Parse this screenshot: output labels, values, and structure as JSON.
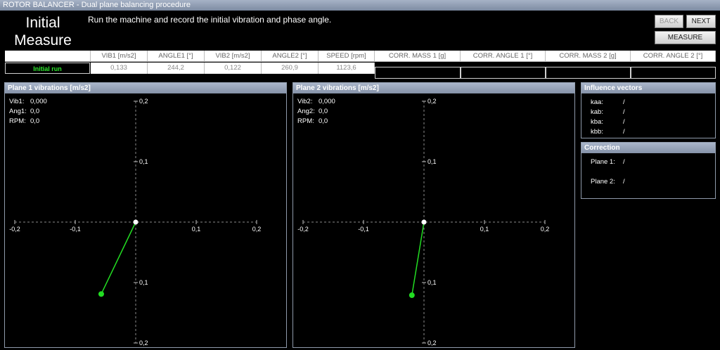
{
  "window": {
    "title": "ROTOR BALANCER - Dual plane balancing procedure"
  },
  "step": {
    "title_line1": "Initial",
    "title_line2": "Measure",
    "instruction": "Run the machine and record the initial vibration and phase angle."
  },
  "buttons": {
    "back": "BACK",
    "next": "NEXT",
    "measure": "MEASURE"
  },
  "table": {
    "headers": [
      "VIB1 [m/s2]",
      "ANGLE1 [°]",
      "VIB2 [m/s2]",
      "ANGLE2 [°]",
      "SPEED [rpm]"
    ],
    "row_label": "Initial run",
    "values": [
      "0,133",
      "244,2",
      "0,122",
      "260,9",
      "1123,6"
    ],
    "corr_headers": [
      "CORR. MASS 1 [g]",
      "CORR. ANGLE 1 [°]",
      "CORR. MASS 2 [g]",
      "CORR. ANGLE 2 [°]"
    ],
    "corr_values": [
      "",
      "",
      "",
      ""
    ]
  },
  "plane1": {
    "title": "Plane 1 vibrations [m/s2]",
    "readout": [
      {
        "k": "Vib1:",
        "v": "0,000"
      },
      {
        "k": "Ang1:",
        "v": "0,0"
      },
      {
        "k": "RPM:",
        "v": "0,0"
      }
    ],
    "vector": {
      "x": -0.057,
      "y": -0.119
    }
  },
  "plane2": {
    "title": "Plane 2 vibrations [m/s2]",
    "readout": [
      {
        "k": "Vib2:",
        "v": "0,000"
      },
      {
        "k": "Ang2:",
        "v": "0,0"
      },
      {
        "k": "RPM:",
        "v": "0,0"
      }
    ],
    "vector": {
      "x": -0.02,
      "y": -0.121
    }
  },
  "axis": {
    "x_ticks": [
      "-0,2",
      "-0,1",
      "0,1",
      "0,2"
    ],
    "y_ticks": [
      "0,2",
      "0,1",
      "0,1",
      "0,2"
    ]
  },
  "influence": {
    "title": "Influence vectors",
    "rows": [
      {
        "k": "kaa:",
        "v": "/"
      },
      {
        "k": "kab:",
        "v": "/"
      },
      {
        "k": "kba:",
        "v": "/"
      },
      {
        "k": "kbb:",
        "v": "/"
      }
    ]
  },
  "correction": {
    "title": "Correction",
    "rows": [
      {
        "k": "Plane 1:",
        "v": "/"
      },
      {
        "k": "Plane 2:",
        "v": "/"
      }
    ]
  },
  "colors": {
    "vector": "#22dd22",
    "header": "#8f9bb0",
    "accent_text": "#2ee82e"
  }
}
